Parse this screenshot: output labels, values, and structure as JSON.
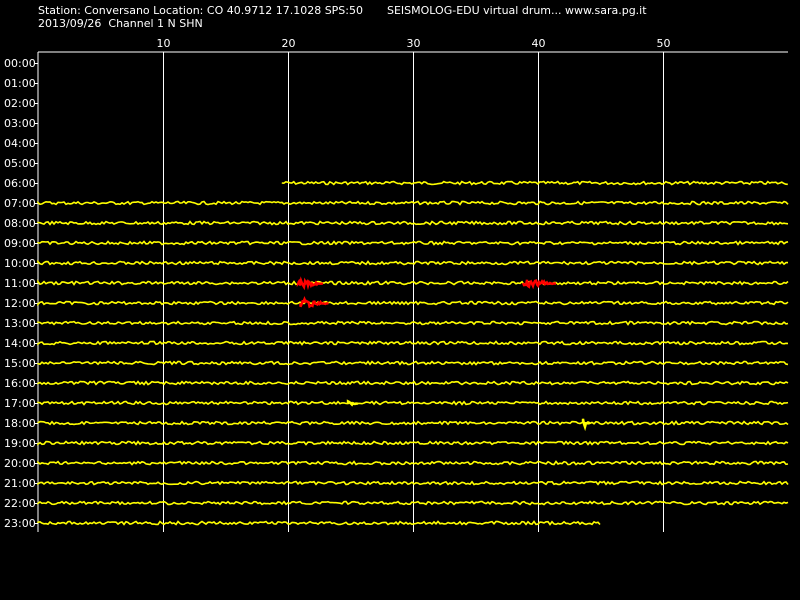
{
  "header": {
    "station_line": "Station: Conversano Location: CO 40.9712 17.1028 SPS:50",
    "title": "SEISMOLOG-EDU virtual drum... www.sara.pg.it",
    "date_line": "2013/09/26  Channel 1 N SHN"
  },
  "chart_data": {
    "type": "line",
    "title": "SEISMOLOG-EDU virtual drum... www.sara.pg.it",
    "xlabel": "",
    "ylabel": "",
    "x_unit_range": [
      0,
      60
    ],
    "x_ticks": [
      10,
      20,
      30,
      40,
      50
    ],
    "grid": true,
    "hours": [
      "00:00",
      "01:00",
      "02:00",
      "03:00",
      "04:00",
      "05:00",
      "06:00",
      "07:00",
      "08:00",
      "09:00",
      "10:00",
      "11:00",
      "12:00",
      "13:00",
      "14:00",
      "15:00",
      "16:00",
      "17:00",
      "18:00",
      "19:00",
      "20:00",
      "21:00",
      "22:00",
      "23:00"
    ],
    "traces": [
      {
        "hour": "06:00",
        "start": 19.5,
        "end": 60
      },
      {
        "hour": "07:00",
        "start": 0,
        "end": 60
      },
      {
        "hour": "08:00",
        "start": 0,
        "end": 60
      },
      {
        "hour": "09:00",
        "start": 0,
        "end": 60
      },
      {
        "hour": "10:00",
        "start": 0,
        "end": 60
      },
      {
        "hour": "11:00",
        "start": 0,
        "end": 60
      },
      {
        "hour": "12:00",
        "start": 0,
        "end": 60
      },
      {
        "hour": "13:00",
        "start": 0,
        "end": 60
      },
      {
        "hour": "14:00",
        "start": 0,
        "end": 60
      },
      {
        "hour": "15:00",
        "start": 0,
        "end": 60
      },
      {
        "hour": "16:00",
        "start": 0,
        "end": 60
      },
      {
        "hour": "17:00",
        "start": 0,
        "end": 60
      },
      {
        "hour": "18:00",
        "start": 0,
        "end": 60
      },
      {
        "hour": "19:00",
        "start": 0,
        "end": 60
      },
      {
        "hour": "20:00",
        "start": 0,
        "end": 60
      },
      {
        "hour": "21:00",
        "start": 0,
        "end": 60
      },
      {
        "hour": "22:00",
        "start": 0,
        "end": 60
      },
      {
        "hour": "23:00",
        "start": 0,
        "end": 45
      }
    ],
    "events": [
      {
        "hour": "11:00",
        "start": 20.8,
        "end": 22.8,
        "color": "#ff0000"
      },
      {
        "hour": "11:00",
        "start": 38.8,
        "end": 41.5,
        "color": "#ff0000"
      },
      {
        "hour": "12:00",
        "start": 21.0,
        "end": 23.3,
        "color": "#ff0000"
      },
      {
        "hour": "17:00",
        "start": 24.8,
        "end": 25.6,
        "color": "#ffff00"
      },
      {
        "hour": "18:00",
        "start": 43.6,
        "end": 44.2,
        "color": "#ffff00"
      }
    ],
    "colors": {
      "trace": "#ffff00",
      "event": "#ff0000",
      "grid": "#ffffff",
      "background": "#000000"
    }
  }
}
